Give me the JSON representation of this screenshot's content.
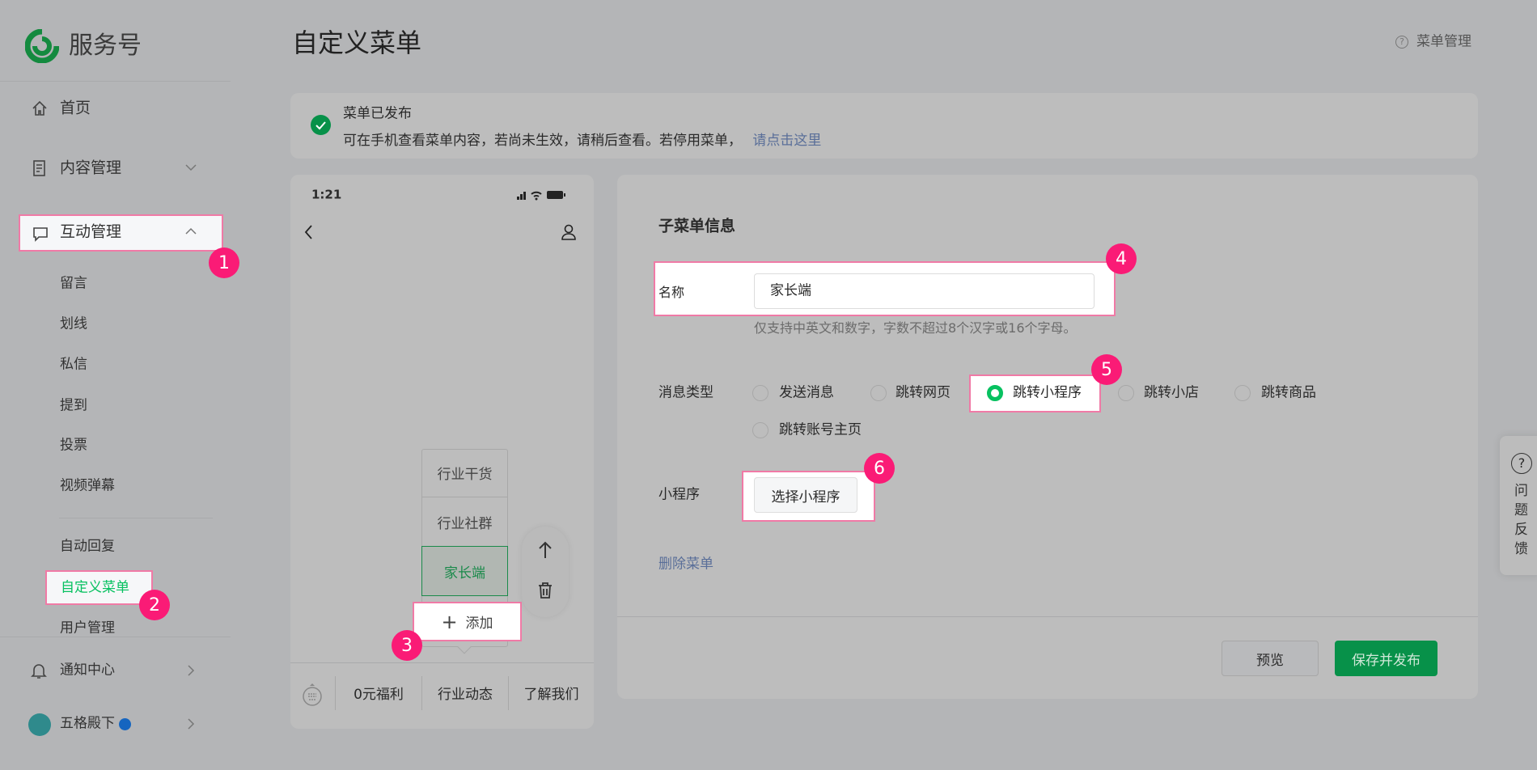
{
  "brand": {
    "name": "服务号"
  },
  "sidebar": {
    "items": [
      {
        "label": "首页"
      },
      {
        "label": "内容管理"
      },
      {
        "label": "互动管理"
      }
    ],
    "sub_items": [
      {
        "label": "留言"
      },
      {
        "label": "划线"
      },
      {
        "label": "私信"
      },
      {
        "label": "提到"
      },
      {
        "label": "投票"
      },
      {
        "label": "视频弹幕"
      },
      {
        "label": "自动回复"
      },
      {
        "label": "自定义菜单"
      },
      {
        "label": "用户管理"
      }
    ],
    "notifications": "通知中心",
    "account": "五格殿下"
  },
  "header": {
    "title": "自定义菜单",
    "help_link": "菜单管理"
  },
  "notice": {
    "title": "菜单已发布",
    "text": "可在手机查看菜单内容，若尚未生效，请稍后查看。若停用菜单，",
    "link": "请点击这里"
  },
  "phone": {
    "time": "1:21",
    "submenu": [
      {
        "label": "行业干货"
      },
      {
        "label": "行业社群"
      },
      {
        "label": "家长端"
      }
    ],
    "add_label": "添加",
    "menu": [
      {
        "label": "0元福利"
      },
      {
        "label": "行业动态"
      },
      {
        "label": "了解我们"
      }
    ]
  },
  "form": {
    "section_title": "子菜单信息",
    "name_label": "名称",
    "name_value": "家长端",
    "name_hint": "仅支持中英文和数字，字数不超过8个汉字或16个字母。",
    "type_label": "消息类型",
    "types": [
      {
        "label": "发送消息"
      },
      {
        "label": "跳转网页"
      },
      {
        "label": "跳转小程序"
      },
      {
        "label": "跳转小店"
      },
      {
        "label": "跳转商品"
      },
      {
        "label": "跳转账号主页"
      }
    ],
    "selected_type": "跳转小程序",
    "miniprogram_label": "小程序",
    "select_button": "选择小程序",
    "delete_link": "删除菜单",
    "preview_button": "预览",
    "publish_button": "保存并发布"
  },
  "feedback": {
    "label": "问题反馈"
  },
  "annotations": [
    "1",
    "2",
    "3",
    "4",
    "5",
    "6"
  ],
  "colors": {
    "accent": "#07c160",
    "badge": "#fa1b76",
    "publish": "#079149",
    "link": "#5a6f99"
  }
}
